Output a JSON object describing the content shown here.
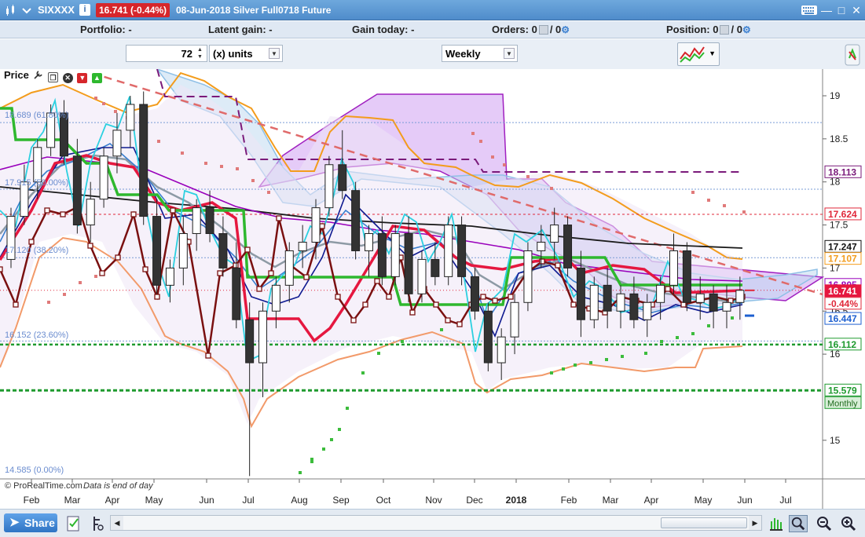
{
  "window": {
    "symbol": "SIXXXX",
    "price_badge": "16.741 (-0.44%)",
    "description": "08-Jun-2018 Silver Full0718 Future",
    "icons": [
      "chart-icon",
      "dropdown-chevron-icon",
      "info-icon",
      "keyboard-icon",
      "minimize-icon",
      "maximize-icon",
      "close-icon"
    ]
  },
  "infobar": {
    "portfolio_label": "Portfolio:",
    "portfolio_value": "-",
    "latent_label": "Latent gain:",
    "latent_value": "-",
    "gain_today_label": "Gain today:",
    "gain_today_value": "-",
    "orders_label": "Orders:",
    "orders_value": "0",
    "orders_value2": "/ 0",
    "position_label": "Position:",
    "position_value": "0",
    "position_value2": "/ 0"
  },
  "toolbar": {
    "units_value": "72",
    "units_label": "(x) units",
    "timeframe": "Weekly"
  },
  "panel": {
    "label": "Price",
    "footer": "© ProRealTime.com",
    "footer_note": "Data is end of day"
  },
  "fib_labels": [
    "18.689 (61.80%)",
    "17.915 (50.00%)",
    "17.120 (38.20%)",
    "16.152 (23.60%)",
    "14.585 (0.00%)"
  ],
  "axis_badges": {
    "b18113": "18.113",
    "b17624": "17.624",
    "b17247": "17.247",
    "b17107": "17.107",
    "b16805": "16.805",
    "b16741": "16.741",
    "pct": "-0.44%",
    "b16447": "16.447",
    "b16112": "16.112",
    "b15579": "15.579",
    "monthly": "Monthly"
  },
  "bottombar": {
    "share_label": "Share"
  },
  "colors": {
    "title_bg": "#4f8ccb",
    "badge_red": "#d6262b",
    "green": "#2eb82e",
    "crimson": "#e5173f",
    "cloud": "#c58cf0"
  },
  "chart_data": {
    "type": "candlestick",
    "timeframe": "Weekly",
    "y_ticks": [
      "19",
      "18.5",
      "18",
      "17.5",
      "17",
      "16.5",
      "16",
      "15"
    ],
    "x_ticks": [
      "Feb",
      "Mar",
      "Apr",
      "May",
      "Jun",
      "Jul",
      "Aug",
      "Sep",
      "Oct",
      "Nov",
      "Dec",
      "2018",
      "Feb",
      "Mar",
      "Apr",
      "May",
      "Jun",
      "Jul"
    ],
    "ylim": [
      14.585,
      19.2
    ],
    "last_price": 16.741,
    "change": "-0.44%",
    "fibonacci": [
      {
        "level": 18.689,
        "pct": "61.80%"
      },
      {
        "level": 17.915,
        "pct": "50.00%"
      },
      {
        "level": 17.12,
        "pct": "38.20%"
      },
      {
        "level": 16.152,
        "pct": "23.60%"
      },
      {
        "level": 14.585,
        "pct": "0.00%"
      }
    ],
    "candles": [
      [
        17.1,
        17.7,
        17.0,
        17.6
      ],
      [
        17.6,
        18.2,
        17.5,
        18.0
      ],
      [
        18.0,
        18.5,
        17.8,
        18.4
      ],
      [
        18.4,
        18.9,
        18.3,
        18.8
      ],
      [
        18.8,
        18.95,
        18.2,
        18.3
      ],
      [
        18.3,
        18.5,
        17.4,
        17.5
      ],
      [
        17.5,
        18.0,
        17.3,
        17.8
      ],
      [
        17.8,
        18.4,
        17.7,
        18.3
      ],
      [
        18.3,
        18.8,
        18.1,
        18.6
      ],
      [
        18.6,
        19.0,
        18.4,
        18.9
      ],
      [
        18.9,
        19.05,
        17.5,
        17.6
      ],
      [
        17.6,
        17.8,
        16.7,
        16.8
      ],
      [
        16.8,
        17.1,
        16.6,
        17.0
      ],
      [
        17.0,
        17.6,
        16.8,
        17.4
      ],
      [
        17.4,
        17.8,
        17.2,
        17.7
      ],
      [
        17.7,
        17.9,
        17.3,
        17.4
      ],
      [
        17.4,
        17.6,
        16.9,
        17.0
      ],
      [
        17.0,
        17.3,
        16.3,
        16.4
      ],
      [
        16.4,
        16.6,
        14.585,
        15.9
      ],
      [
        15.9,
        16.6,
        15.5,
        16.5
      ],
      [
        16.5,
        16.9,
        16.3,
        16.8
      ],
      [
        16.8,
        17.3,
        16.6,
        17.2
      ],
      [
        17.2,
        17.5,
        17.0,
        17.3
      ],
      [
        17.3,
        17.8,
        17.1,
        17.7
      ],
      [
        17.7,
        18.3,
        17.6,
        18.2
      ],
      [
        18.2,
        18.6,
        17.8,
        17.9
      ],
      [
        17.9,
        18.0,
        17.1,
        17.2
      ],
      [
        17.2,
        17.5,
        16.9,
        17.4
      ],
      [
        17.4,
        17.6,
        16.8,
        16.9
      ],
      [
        16.9,
        17.5,
        16.8,
        17.4
      ],
      [
        17.4,
        17.6,
        16.6,
        16.7
      ],
      [
        16.7,
        17.2,
        16.6,
        17.1
      ],
      [
        17.1,
        17.3,
        16.8,
        16.9
      ],
      [
        16.9,
        17.6,
        16.8,
        17.5
      ],
      [
        17.5,
        17.6,
        16.8,
        16.9
      ],
      [
        16.9,
        17.0,
        16.4,
        16.5
      ],
      [
        16.5,
        16.6,
        15.8,
        15.9
      ],
      [
        15.9,
        16.3,
        15.7,
        16.2
      ],
      [
        16.2,
        16.7,
        16.0,
        16.6
      ],
      [
        16.6,
        17.3,
        16.5,
        17.2
      ],
      [
        17.2,
        17.5,
        17.0,
        17.3
      ],
      [
        17.3,
        17.7,
        17.1,
        17.5
      ],
      [
        17.5,
        17.6,
        16.9,
        17.0
      ],
      [
        17.0,
        17.2,
        16.2,
        16.4
      ],
      [
        16.4,
        16.9,
        16.3,
        16.8
      ],
      [
        16.8,
        17.0,
        16.3,
        16.5
      ],
      [
        16.5,
        16.8,
        16.3,
        16.7
      ],
      [
        16.7,
        16.9,
        16.3,
        16.4
      ],
      [
        16.4,
        16.7,
        16.2,
        16.6
      ],
      [
        16.6,
        16.9,
        16.4,
        16.8
      ],
      [
        16.8,
        17.4,
        16.7,
        17.2
      ],
      [
        17.2,
        17.3,
        16.5,
        16.6
      ],
      [
        16.6,
        16.9,
        16.4,
        16.7
      ],
      [
        16.7,
        16.8,
        16.3,
        16.5
      ],
      [
        16.5,
        16.8,
        16.3,
        16.6
      ],
      [
        16.6,
        16.9,
        16.4,
        16.741
      ]
    ]
  }
}
